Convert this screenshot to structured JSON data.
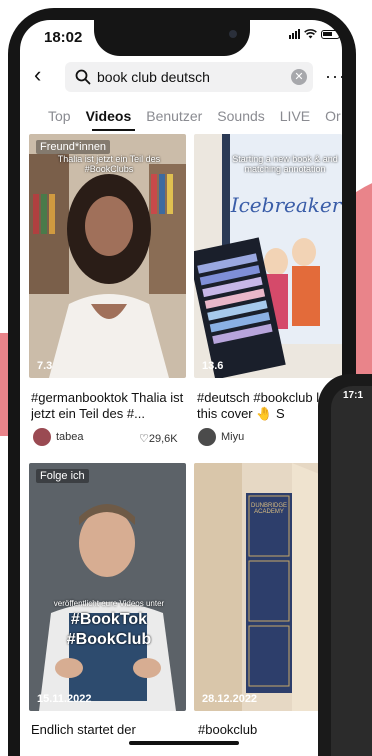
{
  "status_bar": {
    "time": "18:02"
  },
  "search": {
    "query": "book club deutsch",
    "clear_icon": "clear-icon",
    "more_label": "···"
  },
  "tabs": [
    "Top",
    "Videos",
    "Benutzer",
    "Sounds",
    "LIVE",
    "Or"
  ],
  "active_tab": "Videos",
  "videos": [
    {
      "badge": "Freund*innen",
      "overlay": "Thalia ist jetzt ein Teil des\n#BookClubs",
      "views": "7.3",
      "caption": "#germanbooktok Thalia ist jetzt ein Teil des #...",
      "author": "tabea",
      "likes": "♡29,6K"
    },
    {
      "badge": "",
      "overlay": "Starting a new book & and matching annotation",
      "views": "13.6",
      "caption": "#deutsch #bookclub love this cover 🤚 S",
      "author": "Miyu",
      "likes": ""
    },
    {
      "badge": "Folge ich",
      "overlay": "veröffentlicht eure Videos unter",
      "views": "15.11.2022",
      "caption": "Endlich startet der",
      "author": "",
      "likes": ""
    },
    {
      "badge": "",
      "overlay": "DUNBRIDGE ACADEMY",
      "views": "28.12.2022",
      "caption": "#bookclub",
      "author": "",
      "likes": ""
    }
  ],
  "overlay_tags": {
    "booktok": "#BookTok",
    "bookclub": "#BookClub"
  },
  "book_cover_title": "Icebreaker",
  "second_phone": {
    "time": "17:1"
  },
  "colors": {
    "accent_pink": "#e9848a",
    "phone_frame": "#151515",
    "tab_inactive": "#8a8b91"
  }
}
